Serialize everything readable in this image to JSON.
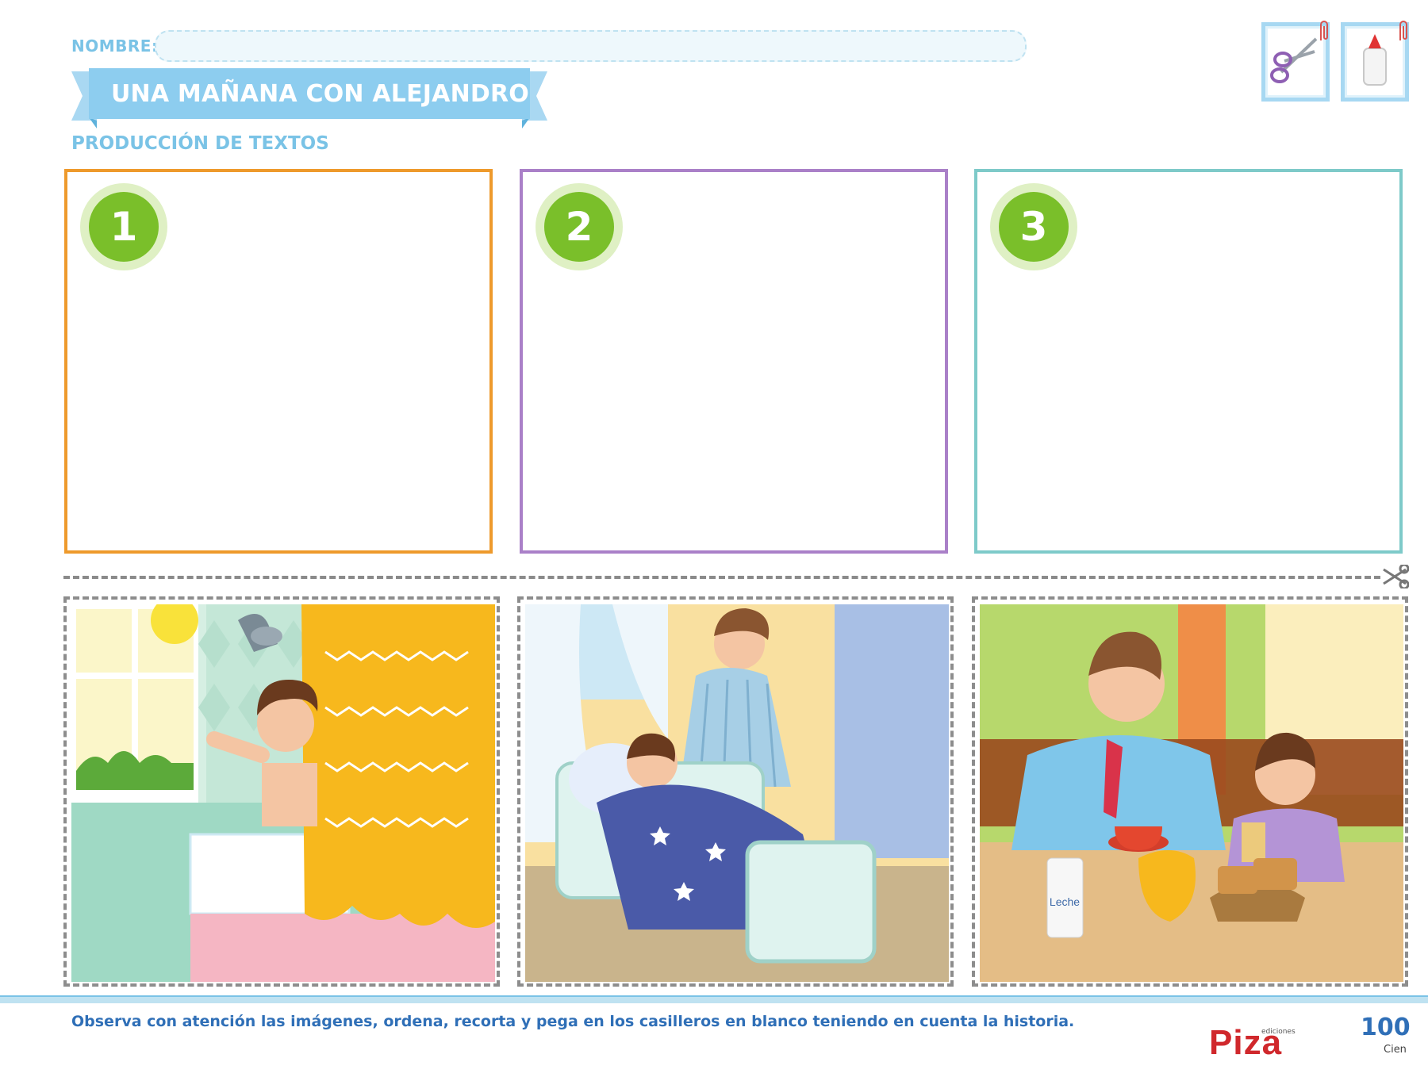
{
  "header": {
    "name_label": "NOMBRE:",
    "title": "UNA MAÑANA CON ALEJANDRO",
    "subtitle": "PRODUCCIÓN DE TEXTOS",
    "tools": [
      "scissors-icon",
      "glue-icon"
    ]
  },
  "frames": [
    {
      "number": "1",
      "color": "#ee9a2c"
    },
    {
      "number": "2",
      "color": "#aa80c8"
    },
    {
      "number": "3",
      "color": "#7ecac9"
    }
  ],
  "cards": [
    {
      "scene": "bathroom-shower"
    },
    {
      "scene": "bedroom-wake-up"
    },
    {
      "scene": "breakfast"
    }
  ],
  "breakfast_milk_label": "Leche",
  "footer": {
    "instruction": "Observa con atención las imágenes, ordena, recorta y pega en los casilleros en blanco teniendo en cuenta la historia.",
    "brand_small": "ediciones",
    "brand": "Piza",
    "page_number": "100",
    "page_word": "Cien"
  },
  "colors": {
    "accent_blue": "#7ac3e6",
    "badge_green": "#7abf2a",
    "text_blue": "#2f6fb7",
    "brand_red": "#d0282c"
  }
}
